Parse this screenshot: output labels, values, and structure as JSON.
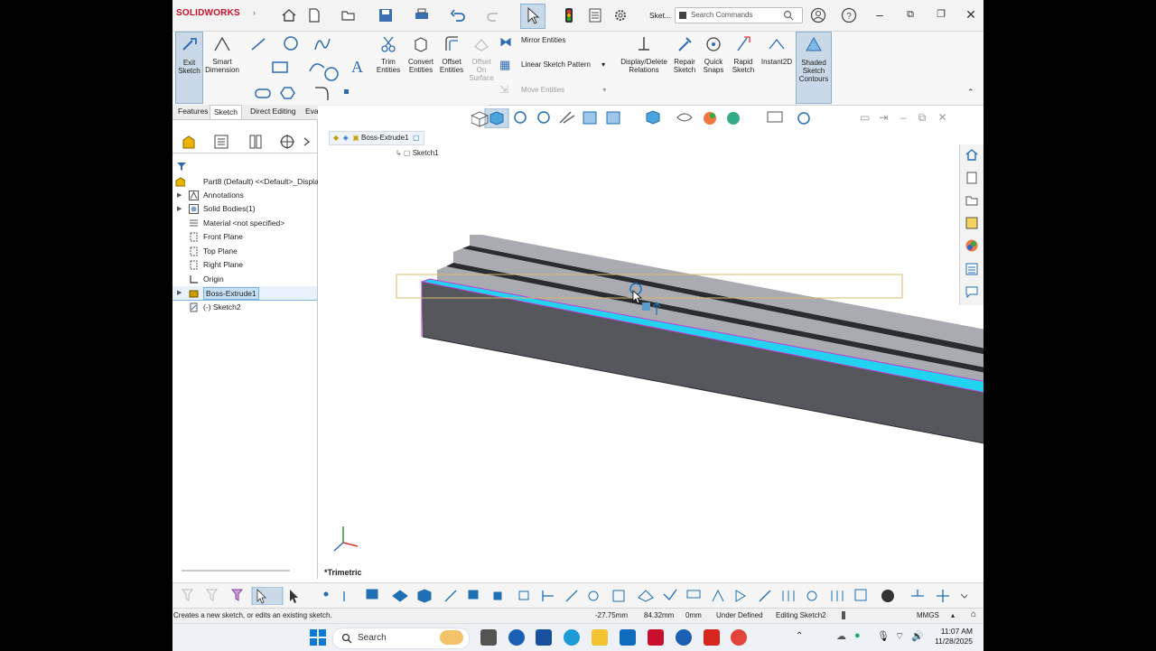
{
  "titlebar": {
    "brand": "SOLIDWORKS",
    "doc_short": "Sket...",
    "search_placeholder": "Search Commands"
  },
  "ribbon": {
    "exit_sketch": "Exit Sketch",
    "smart_dimension": "Smart Dimension",
    "trim_entities": "Trim Entities",
    "convert_entities": "Convert Entities",
    "offset_entities": "Offset Entities",
    "offset_on_surface": "Offset On Surface",
    "mirror_entities": "Mirror Entities",
    "linear_sketch_pattern": "Linear Sketch Pattern",
    "move_entities": "Move Entities",
    "display_delete_relations": "Display/Delete Relations",
    "repair_sketch": "Repair Sketch",
    "quick_snaps": "Quick Snaps",
    "rapid_sketch": "Rapid Sketch",
    "instant2d": "Instant2D",
    "shaded_sketch_contours": "Shaded Sketch Contours"
  },
  "tabs": [
    "Features",
    "Sketch",
    "Direct Editing",
    "Evaluate"
  ],
  "tree": {
    "root": "Part8 (Default) <<Default>_Displa",
    "items": [
      {
        "label": "Annotations",
        "arrow": true
      },
      {
        "label": "Solid Bodies(1)",
        "arrow": true
      },
      {
        "label": "Material <not specified>",
        "arrow": false
      },
      {
        "label": "Front Plane",
        "arrow": false
      },
      {
        "label": "Top Plane",
        "arrow": false
      },
      {
        "label": "Right Plane",
        "arrow": false
      },
      {
        "label": "Origin",
        "arrow": false
      },
      {
        "label": "Boss-Extrude1",
        "arrow": true
      },
      {
        "label": "(-) Sketch2",
        "arrow": false
      }
    ]
  },
  "breadcrumb": {
    "feature": "Boss-Extrude1",
    "sketch": "Sketch1"
  },
  "view_label": "*Trimetric",
  "status": {
    "hint": "Creates a new sketch, or edits an existing sketch.",
    "x": "-27.75mm",
    "y": "84.32mm",
    "z": "0mm",
    "state": "Under Defined",
    "editing": "Editing Sketch2",
    "units": "MMGS"
  },
  "taskbar": {
    "search": "Search",
    "time": "11:07 AM",
    "date": "11/28/2025"
  },
  "colors": {
    "highlight_face": "#22d3f0",
    "body_dark": "#55575c",
    "body_light": "#a9abb0",
    "accent_blue": "#1f6fb5"
  }
}
